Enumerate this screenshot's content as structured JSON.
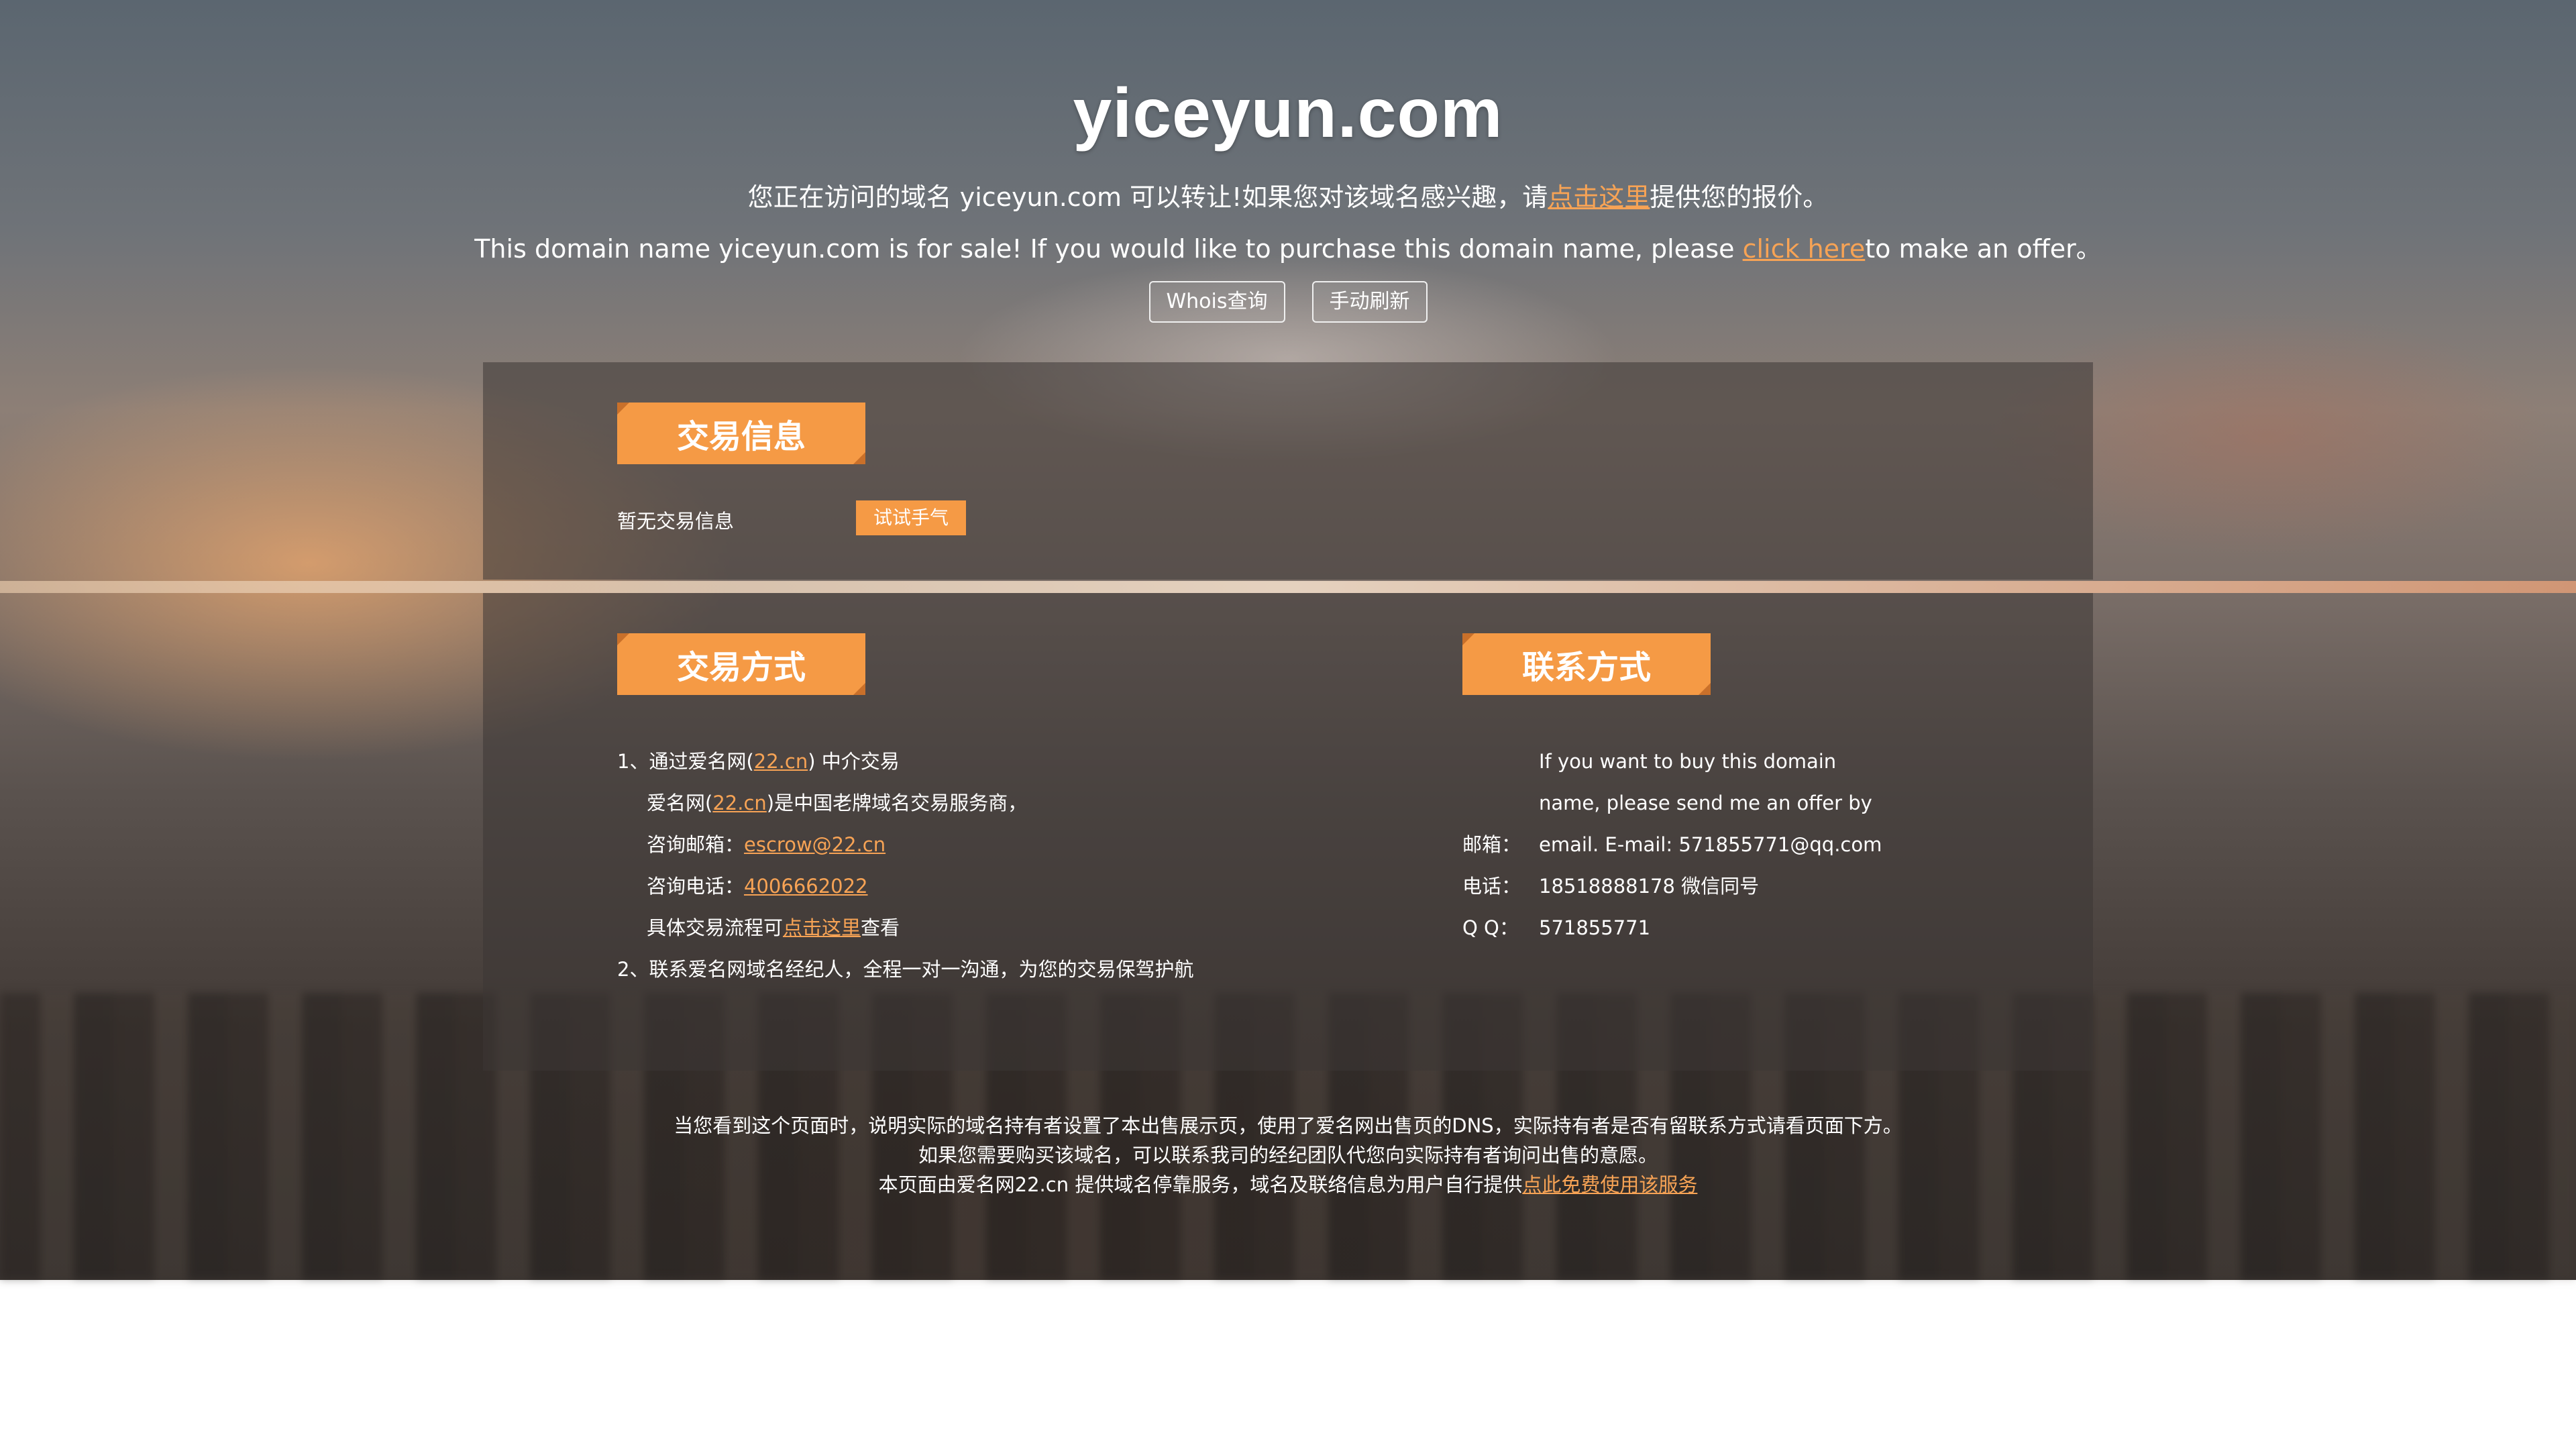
{
  "header": {
    "title": "yiceyun.com",
    "cn_pre": "您正在访问的域名 yiceyun.com 可以转让!如果您对该域名感兴趣，请",
    "cn_link": "点击这里",
    "cn_post": "提供您的报价。",
    "en_pre": "This domain name yiceyun.com is for sale! If you would like to purchase this domain name, please ",
    "en_link": "click here",
    "en_post": "to make an offer。",
    "btn_whois": "Whois查询",
    "btn_refresh": "手动刷新"
  },
  "trade_info": {
    "heading": "交易信息",
    "empty_text": "暂无交易信息",
    "try_button": "试试手气"
  },
  "trade_method": {
    "heading": "交易方式",
    "item1_pre": "1、通过爱名网(",
    "item1_link": "22.cn",
    "item1_post": ") 中介交易",
    "desc_pre": "爱名网(",
    "desc_link": "22.cn",
    "desc_post": ")是中国老牌域名交易服务商，",
    "email_label": "咨询邮箱：",
    "email_value": "escrow@22.cn",
    "phone_label": "咨询电话：",
    "phone_value": "4006662022",
    "flow_pre": "具体交易流程可",
    "flow_link": "点击这里",
    "flow_post": "查看",
    "item2": "2、联系爱名网域名经纪人，全程一对一沟通，为您的交易保驾护航"
  },
  "contact": {
    "heading": "联系方式",
    "intro1": "If you want to buy this domain",
    "intro2": "name, please send me an offer by",
    "email_label": "邮箱：",
    "email_value": "email. E-mail: 571855771@qq.com",
    "phone_label": "电话：",
    "phone_value": "18518888178 微信同号",
    "qq_label": "Q Q：",
    "qq_value": "571855771"
  },
  "footer": {
    "line1": "当您看到这个页面时，说明实际的域名持有者设置了本出售展示页，使用了爱名网出售页的DNS，实际持有者是否有留联系方式请看页面下方。",
    "line2": "如果您需要购买该域名，可以联系我司的经纪团队代您向实际持有者询问出售的意愿。",
    "line3_pre": "本页面由爱名网22.cn 提供域名停靠服务，域名及联络信息为用户自行提供",
    "line3_link": "点此免费使用该服务"
  },
  "colors": {
    "accent": "#f59a45",
    "link": "#f7a355"
  }
}
